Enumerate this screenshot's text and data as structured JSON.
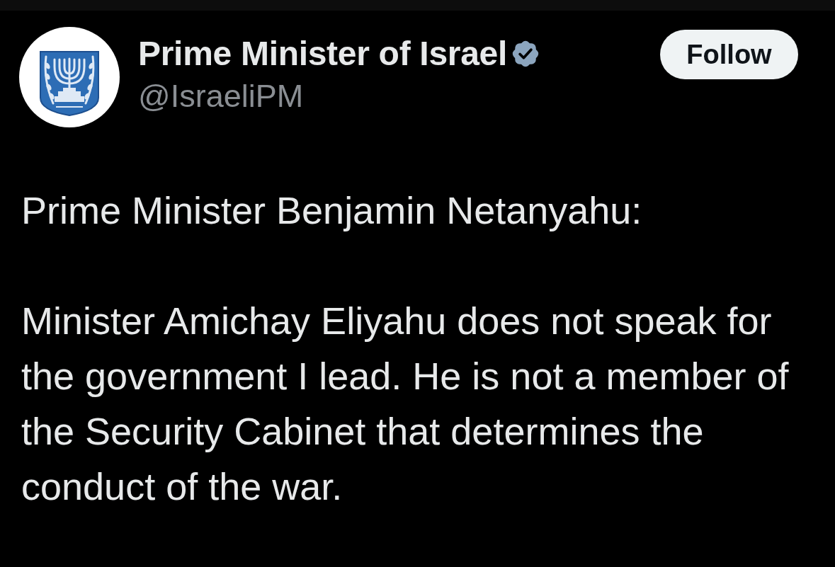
{
  "post": {
    "author": {
      "name": "Prime Minister of Israel",
      "verified": true,
      "handle": "@IsraeliPM"
    },
    "follow_button": {
      "label": "Follow"
    },
    "paragraphs": [
      "Prime Minister Benjamin Netanyahu:",
      "Minister Amichay Eliyahu does not speak for the government I lead. He is not a member of the Security Cabinet that determines the conduct of the war."
    ]
  }
}
